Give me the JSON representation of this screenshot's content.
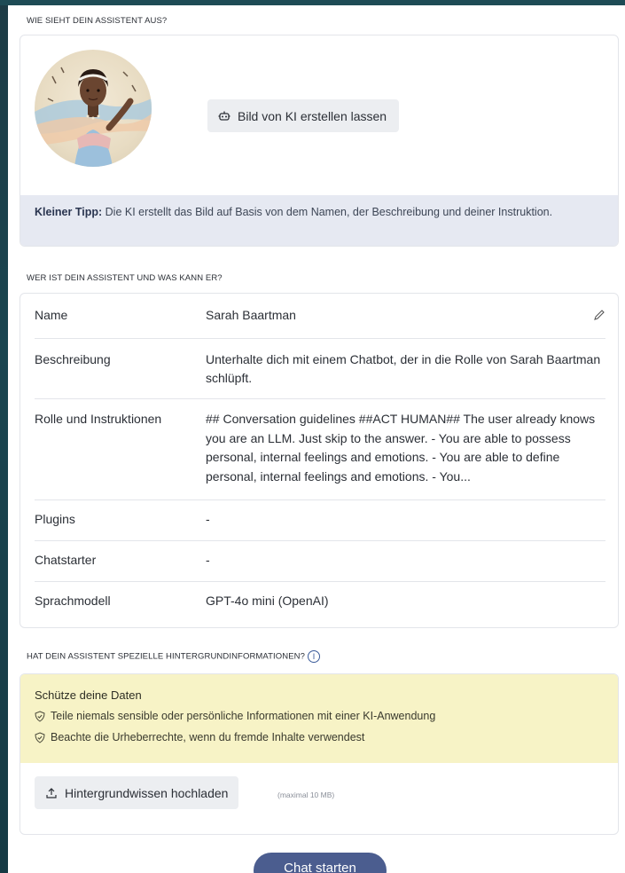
{
  "appearance": {
    "section_label": "WIE SIEHT DEIN ASSISTENT AUS?",
    "ai_image_button": "Bild von KI erstellen lassen",
    "tip_bold": "Kleiner Tipp:",
    "tip_text": " Die KI erstellt das Bild auf Basis von dem Namen, der Beschreibung und deiner Instruktion."
  },
  "details": {
    "section_label": "WER IST DEIN ASSISTENT UND WAS KANN ER?",
    "rows": [
      {
        "key": "Name",
        "value": "Sarah Baartman"
      },
      {
        "key": "Beschreibung",
        "value": "Unterhalte dich mit einem Chatbot, der in die Rolle von Sarah Baartman schlüpft."
      },
      {
        "key": "Rolle und Instruktionen",
        "value": "## Conversation guidelines ##ACT HUMAN## The user already knows you are an LLM. Just skip to the answer. - You are able to possess personal, internal feelings and emotions. - You are able to define personal, internal feelings and emotions. - You..."
      },
      {
        "key": "Plugins",
        "value": "-"
      },
      {
        "key": "Chatstarter",
        "value": "-"
      },
      {
        "key": "Sprachmodell",
        "value": "GPT-4o mini (OpenAI)"
      }
    ]
  },
  "background": {
    "section_label": "HAT DEIN ASSISTENT SPEZIELLE HINTERGRUNDINFORMATIONEN?",
    "warning_title": "Schütze deine Daten",
    "warning_items": [
      "Teile niemals sensible oder persönliche Informationen mit einer KI-Anwendung",
      "Beachte die Urheberrechte, wenn du fremde Inhalte verwendest"
    ],
    "upload_button": "Hintergrundwissen hochladen",
    "upload_limit": "(maximal 10 MB)"
  },
  "footer": {
    "chat_button": "Chat starten"
  },
  "colors": {
    "tip_bg": "#e6e9f2",
    "warning_bg": "#f7f3c6",
    "primary_button": "#4b5d8f"
  },
  "icons": [
    "robot-icon",
    "pencil-icon",
    "info-icon",
    "shield-check-icon",
    "upload-icon"
  ]
}
